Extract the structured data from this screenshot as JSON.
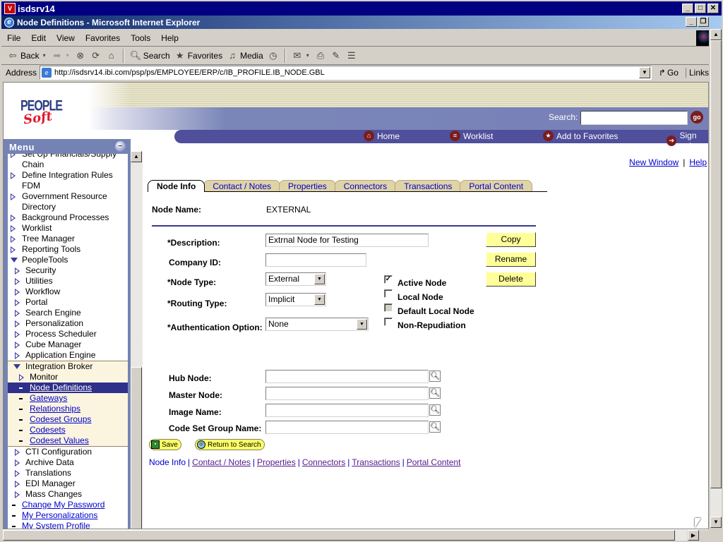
{
  "outer_window": {
    "title": "isdsrv14",
    "app_icon": "vnc-icon"
  },
  "browser": {
    "title": "Node Definitions - Microsoft Internet Explorer",
    "menu": [
      "File",
      "Edit",
      "View",
      "Favorites",
      "Tools",
      "Help"
    ],
    "toolbar": {
      "back": "Back",
      "search": "Search",
      "favorites": "Favorites",
      "media": "Media"
    },
    "address_label": "Address",
    "url": "http://isdsrv14.ibi.com/psp/ps/EMPLOYEE/ERP/c/IB_PROFILE.IB_NODE.GBL",
    "go": "Go",
    "links": "Links"
  },
  "header": {
    "logo_top": "PEOPLE",
    "logo_bottom": "Soft",
    "search_label": "Search:",
    "search_value": "",
    "go_label": "go",
    "nav": [
      {
        "label": "Home",
        "icon": "home-icon"
      },
      {
        "label": "Worklist",
        "icon": "worklist-icon"
      },
      {
        "label": "Add to Favorites",
        "icon": "favorites-icon"
      },
      {
        "label": "Sign out",
        "icon": "signout-icon"
      }
    ]
  },
  "menu": {
    "title": "Menu",
    "items": [
      {
        "label": "Set Up Financials/Supply",
        "level": 1,
        "type": "folder"
      },
      {
        "label": "Chain",
        "level": 1,
        "type": "cont"
      },
      {
        "label": "Define Integration Rules",
        "level": 1,
        "type": "folder"
      },
      {
        "label": "FDM",
        "level": 1,
        "type": "cont"
      },
      {
        "label": "Government Resource",
        "level": 1,
        "type": "folder"
      },
      {
        "label": "Directory",
        "level": 1,
        "type": "cont"
      },
      {
        "label": "Background Processes",
        "level": 1,
        "type": "folder"
      },
      {
        "label": "Worklist",
        "level": 1,
        "type": "folder"
      },
      {
        "label": "Tree Manager",
        "level": 1,
        "type": "folder"
      },
      {
        "label": "Reporting Tools",
        "level": 1,
        "type": "folder"
      },
      {
        "label": "PeopleTools",
        "level": 1,
        "type": "open"
      },
      {
        "label": "Security",
        "level": 2,
        "type": "folder"
      },
      {
        "label": "Utilities",
        "level": 2,
        "type": "folder"
      },
      {
        "label": "Workflow",
        "level": 2,
        "type": "folder"
      },
      {
        "label": "Portal",
        "level": 2,
        "type": "folder"
      },
      {
        "label": "Search Engine",
        "level": 2,
        "type": "folder"
      },
      {
        "label": "Personalization",
        "level": 2,
        "type": "folder"
      },
      {
        "label": "Process Scheduler",
        "level": 2,
        "type": "folder"
      },
      {
        "label": "Cube Manager",
        "level": 2,
        "type": "folder"
      },
      {
        "label": "Application Engine",
        "level": 2,
        "type": "folder"
      }
    ],
    "integration_broker": {
      "label": "Integration Broker",
      "items": [
        {
          "label": "Monitor",
          "type": "folder"
        },
        {
          "label": "Node Definitions",
          "type": "link",
          "selected": true
        },
        {
          "label": "Gateways",
          "type": "link"
        },
        {
          "label": "Relationships",
          "type": "link"
        },
        {
          "label": "Codeset Groups",
          "type": "link"
        },
        {
          "label": "Codesets",
          "type": "link"
        },
        {
          "label": "Codeset Values",
          "type": "link"
        }
      ]
    },
    "after_items": [
      {
        "label": "CTI Configuration",
        "level": 2,
        "type": "folder"
      },
      {
        "label": "Archive Data",
        "level": 2,
        "type": "folder"
      },
      {
        "label": "Translations",
        "level": 2,
        "type": "folder"
      },
      {
        "label": "EDI Manager",
        "level": 2,
        "type": "folder"
      },
      {
        "label": "Mass Changes",
        "level": 2,
        "type": "folder"
      },
      {
        "label": "Change My Password",
        "level": 1,
        "type": "link"
      },
      {
        "label": "My Personalizations",
        "level": 1,
        "type": "link"
      },
      {
        "label": "My System Profile",
        "level": 1,
        "type": "link"
      }
    ]
  },
  "page": {
    "top_links": {
      "new_window": "New Window",
      "help": "Help"
    },
    "tabs": [
      {
        "label": "Node Info",
        "active": true
      },
      {
        "label": "Contact / Notes"
      },
      {
        "label": "Properties"
      },
      {
        "label": "Connectors"
      },
      {
        "label": "Transactions"
      },
      {
        "label": "Portal Content"
      }
    ],
    "node_name_label": "Node Name:",
    "node_name": "EXTERNAL",
    "fields": {
      "description": {
        "label": "*Description:",
        "value": "Extrnal Node for Testing"
      },
      "company_id": {
        "label": "Company ID:",
        "value": ""
      },
      "node_type": {
        "label": "*Node Type:",
        "value": "External"
      },
      "routing_type": {
        "label": "*Routing Type:",
        "value": "Implicit"
      },
      "auth_option": {
        "label": "*Authentication Option:",
        "value": "None"
      },
      "hub_node": {
        "label": "Hub Node:",
        "value": ""
      },
      "master_node": {
        "label": "Master Node:",
        "value": ""
      },
      "image_name": {
        "label": "Image Name:",
        "value": ""
      },
      "code_set_group": {
        "label": "Code Set Group Name:",
        "value": ""
      }
    },
    "checkboxes": [
      {
        "label": "Active Node",
        "checked": true,
        "disabled": false
      },
      {
        "label": "Local Node",
        "checked": false,
        "disabled": false
      },
      {
        "label": "Default Local Node",
        "checked": false,
        "disabled": true
      },
      {
        "label": "Non-Repudiation",
        "checked": false,
        "disabled": false
      }
    ],
    "buttons": {
      "copy": "Copy",
      "rename": "Rename",
      "delete": "Delete"
    },
    "save": "Save",
    "return_to_search": "Return to Search",
    "bottom_links": [
      "Node Info",
      "Contact / Notes",
      "Properties",
      "Connectors",
      "Transactions",
      "Portal Content"
    ]
  }
}
